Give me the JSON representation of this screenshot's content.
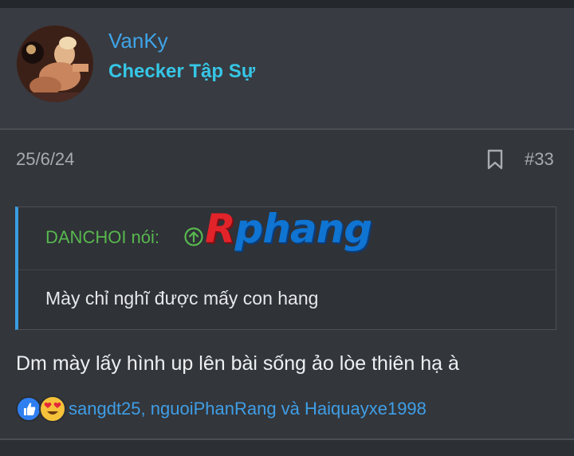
{
  "user": {
    "name": "VanKy",
    "title": "Checker Tập Sự",
    "avatar_icon": "user-avatar"
  },
  "post": {
    "date": "25/6/24",
    "number": "#33",
    "bookmark_icon": "bookmark-icon"
  },
  "quote": {
    "author": "DANCHOI nói:",
    "arrow_icon": "arrow-up-circle-icon",
    "text": "Mày chỉ nghĩ được mấy con hang"
  },
  "watermark": {
    "first": "R",
    "rest": "phang"
  },
  "message": "Dm mày lấy hình up lên bài sống ảo lòe thiên hạ à",
  "reactions": {
    "icons": [
      "like-icon",
      "love-eyes-icon"
    ],
    "users": "sangdt25, nguoiPhanRang và Haiquayxe1998"
  },
  "colors": {
    "background": "#33363b",
    "username": "#3fa4e8",
    "usertitle": "#36c6e6",
    "quote_author": "#58b84e",
    "quote_border": "#3a9de0",
    "link": "#3f9ee6"
  }
}
